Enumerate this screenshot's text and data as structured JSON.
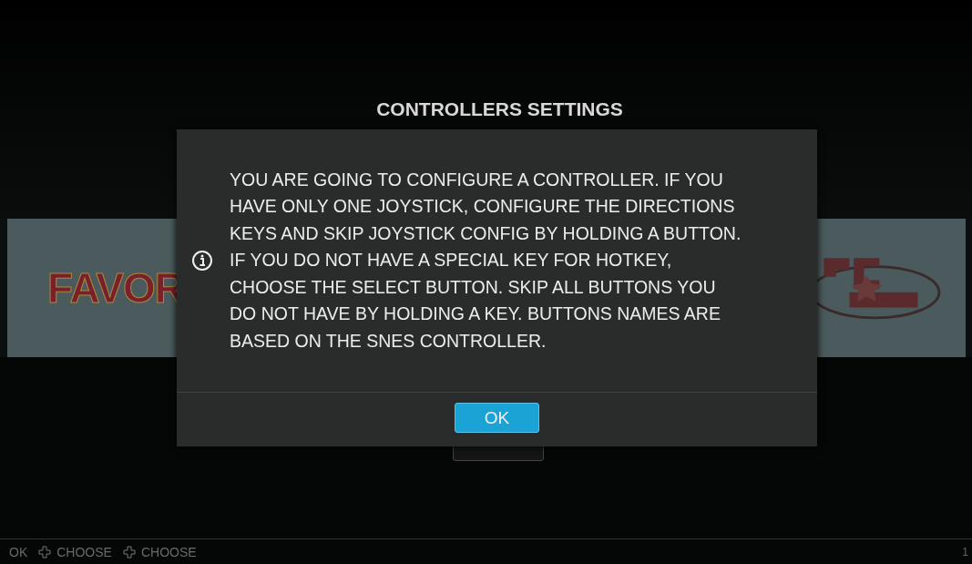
{
  "title": "CONTROLLERS SETTINGS",
  "carousel": [
    {
      "kind": "text-logo",
      "label": "FAVOR"
    },
    {
      "kind": "emblem-logo"
    }
  ],
  "dialog": {
    "message_lines": [
      "YOU ARE GOING TO CONFIGURE A CONTROLLER. IF YOU",
      "HAVE ONLY ONE JOYSTICK, CONFIGURE THE DIRECTIONS",
      "KEYS AND SKIP JOYSTICK CONFIG BY HOLDING A BUTTON.",
      "IF YOU DO NOT HAVE A SPECIAL KEY FOR HOTKEY,",
      "CHOOSE THE SELECT BUTTON. SKIP ALL BUTTONS YOU",
      "DO NOT HAVE BY HOLDING A KEY. BUTTONS NAMES ARE",
      "BASED ON THE SNES CONTROLLER."
    ],
    "buttons": [
      {
        "label": "OK",
        "selected": true
      }
    ]
  },
  "help_bar": [
    {
      "kind": "text",
      "label": "OK"
    },
    {
      "kind": "dpad",
      "label": "CHOOSE"
    },
    {
      "kind": "dpad",
      "label": "CHOOSE"
    }
  ],
  "page_number": "1"
}
